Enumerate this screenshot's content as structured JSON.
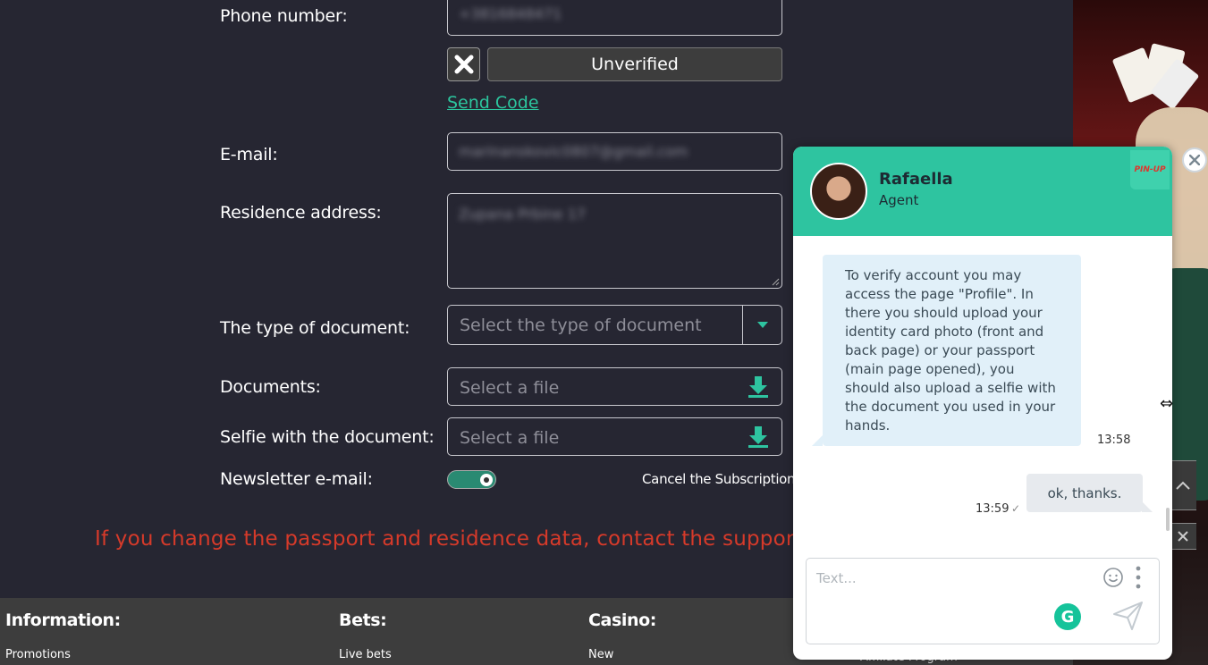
{
  "form": {
    "phone_label": "Phone number:",
    "phone_value": "+3816848471",
    "unverified_label": "Unverified",
    "send_code_label": "Send Code",
    "email_label": "E-mail:",
    "email_value": "marinanskovic0807@gmail.com",
    "address_label": "Residence address:",
    "address_value": "Zupana Prbine 17",
    "doc_type_label": "The type of document:",
    "doc_type_placeholder": "Select the type of document",
    "documents_label": "Documents:",
    "documents_placeholder": "Select a file",
    "selfie_label": "Selfie with the document:",
    "selfie_placeholder": "Select a file",
    "newsletter_label": "Newsletter e-mail:",
    "newsletter_on": true,
    "cancel_subscription": "Cancel the Subscription",
    "warning": "If you change the passport and residence data, contact the support serv"
  },
  "footer": {
    "columns": [
      {
        "heading": "Information:",
        "item": "Promotions"
      },
      {
        "heading": "Bets:",
        "item": "Live bets"
      },
      {
        "heading": "Casino:",
        "item": "New"
      },
      {
        "heading": "",
        "item": "Affiliate Program"
      }
    ]
  },
  "chat": {
    "agent_name": "Rafaella",
    "agent_role": "Agent",
    "brand": "PIN-UP",
    "messages": [
      {
        "from": "agent",
        "text": "To verify account you may access the page \"Profile\". In there you should upload your identity card photo (front and back page) or your passport (main page opened), you should also upload a selfie with the document you used in your hands.",
        "time": "13:58"
      },
      {
        "from": "user",
        "text": "ok, thanks.",
        "time": "13:59",
        "status": "✓"
      }
    ],
    "input_placeholder": "Text..."
  },
  "colors": {
    "accent": "#2ec4a0",
    "warning": "#d63a2a",
    "page_bg": "#262632"
  }
}
